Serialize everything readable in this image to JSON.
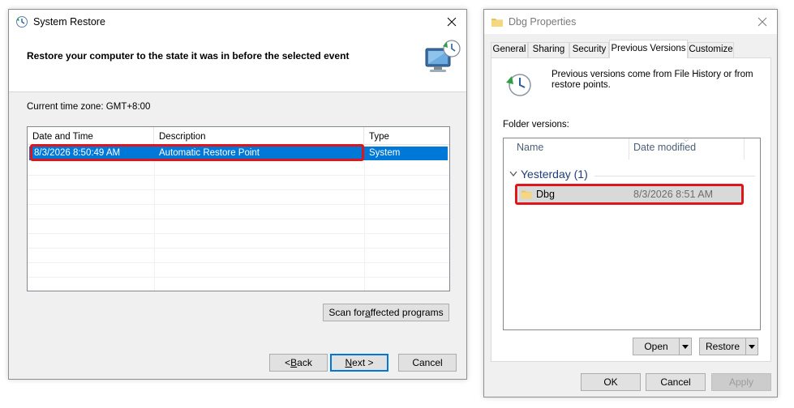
{
  "system_restore": {
    "title": "System Restore",
    "heading": "Restore your computer to the state it was in before the selected event",
    "timezone": "Current time zone: GMT+8:00",
    "columns": [
      "Date and Time",
      "Description",
      "Type"
    ],
    "rows": [
      {
        "date": "8/3/2026 8:50:49 AM",
        "description": "Automatic Restore Point",
        "type": "System"
      }
    ],
    "scan_button": {
      "pre": "Scan for ",
      "u": "a",
      "post": "ffected programs"
    },
    "back_button": {
      "pre": "< ",
      "u": "B",
      "post": "ack"
    },
    "next_button": {
      "pre": "",
      "u": "N",
      "post": "ext >"
    },
    "cancel_button": "Cancel"
  },
  "dbg_properties": {
    "title": "Dbg Properties",
    "tabs": [
      "General",
      "Sharing",
      "Security",
      "Previous Versions",
      "Customize"
    ],
    "active_tab": "Previous Versions",
    "info_text": "Previous versions come from File History or from restore points.",
    "folder_versions_label": "Folder versions:",
    "list_columns": [
      "Name",
      "Date modified"
    ],
    "group_label": "Yesterday (1)",
    "items": [
      {
        "name": "Dbg",
        "date_modified": "8/3/2026 8:51 AM"
      }
    ],
    "open_button": "Open",
    "restore_button": "Restore",
    "ok_button": "OK",
    "cancel_button": "Cancel",
    "apply_button": "Apply"
  },
  "colors": {
    "selection": "#0078d7",
    "highlight": "#e0151c",
    "window_bg": "#f0f0f0",
    "group_text": "#1e3d7a"
  }
}
